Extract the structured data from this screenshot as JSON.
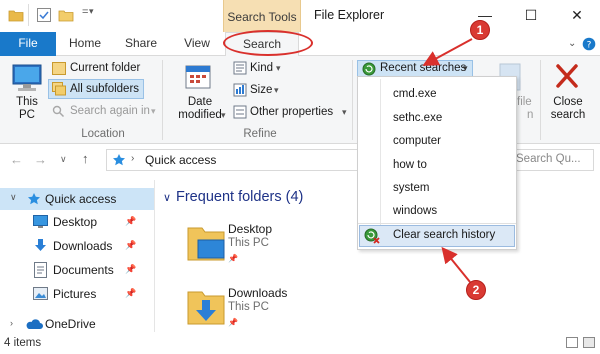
{
  "window": {
    "title": "File Explorer",
    "context_tab_group": "Search Tools",
    "controls": {
      "minimize": "—",
      "maximize": "☐",
      "close": "✕"
    }
  },
  "tabs": {
    "file": "File",
    "home": "Home",
    "share": "Share",
    "view": "View",
    "search": "Search"
  },
  "ribbon": {
    "this_pc": "This PC",
    "current_folder": "Current folder",
    "all_subfolders": "All subfolders",
    "search_again_in": "Search again in",
    "location_group": "Location",
    "date_modified": "Date modified",
    "kind": "Kind",
    "size": "Size",
    "other_properties": "Other properties",
    "refine_group": "Refine",
    "recent_searches": "Recent searches",
    "open_file": "file",
    "open_file_loc": "n",
    "close_search": "Close search"
  },
  "dropdown": {
    "items": [
      "cmd.exe",
      "sethc.exe",
      "computer",
      "how to",
      "system",
      "windows"
    ],
    "clear": "Clear search history"
  },
  "address": {
    "location": "Quick access",
    "search_placeholder": "Search Qu..."
  },
  "nav": {
    "items": [
      {
        "label": "Quick access",
        "pinned": false
      },
      {
        "label": "Desktop",
        "pinned": true
      },
      {
        "label": "Downloads",
        "pinned": true
      },
      {
        "label": "Documents",
        "pinned": true
      },
      {
        "label": "Pictures",
        "pinned": true
      },
      {
        "label": "OneDrive",
        "pinned": false
      }
    ]
  },
  "content": {
    "section_title": "Frequent folders (4)",
    "folders": [
      {
        "name": "Desktop",
        "location": "This PC"
      },
      {
        "name": "Downloads",
        "location": "This PC"
      }
    ]
  },
  "status": {
    "count": "4 items"
  },
  "callouts": {
    "one": "1",
    "two": "2"
  },
  "colors": {
    "accent": "#1979ca",
    "context_tab": "#f6dfb3",
    "annotation": "#d9302c",
    "nav_selected": "#cce4f7"
  }
}
